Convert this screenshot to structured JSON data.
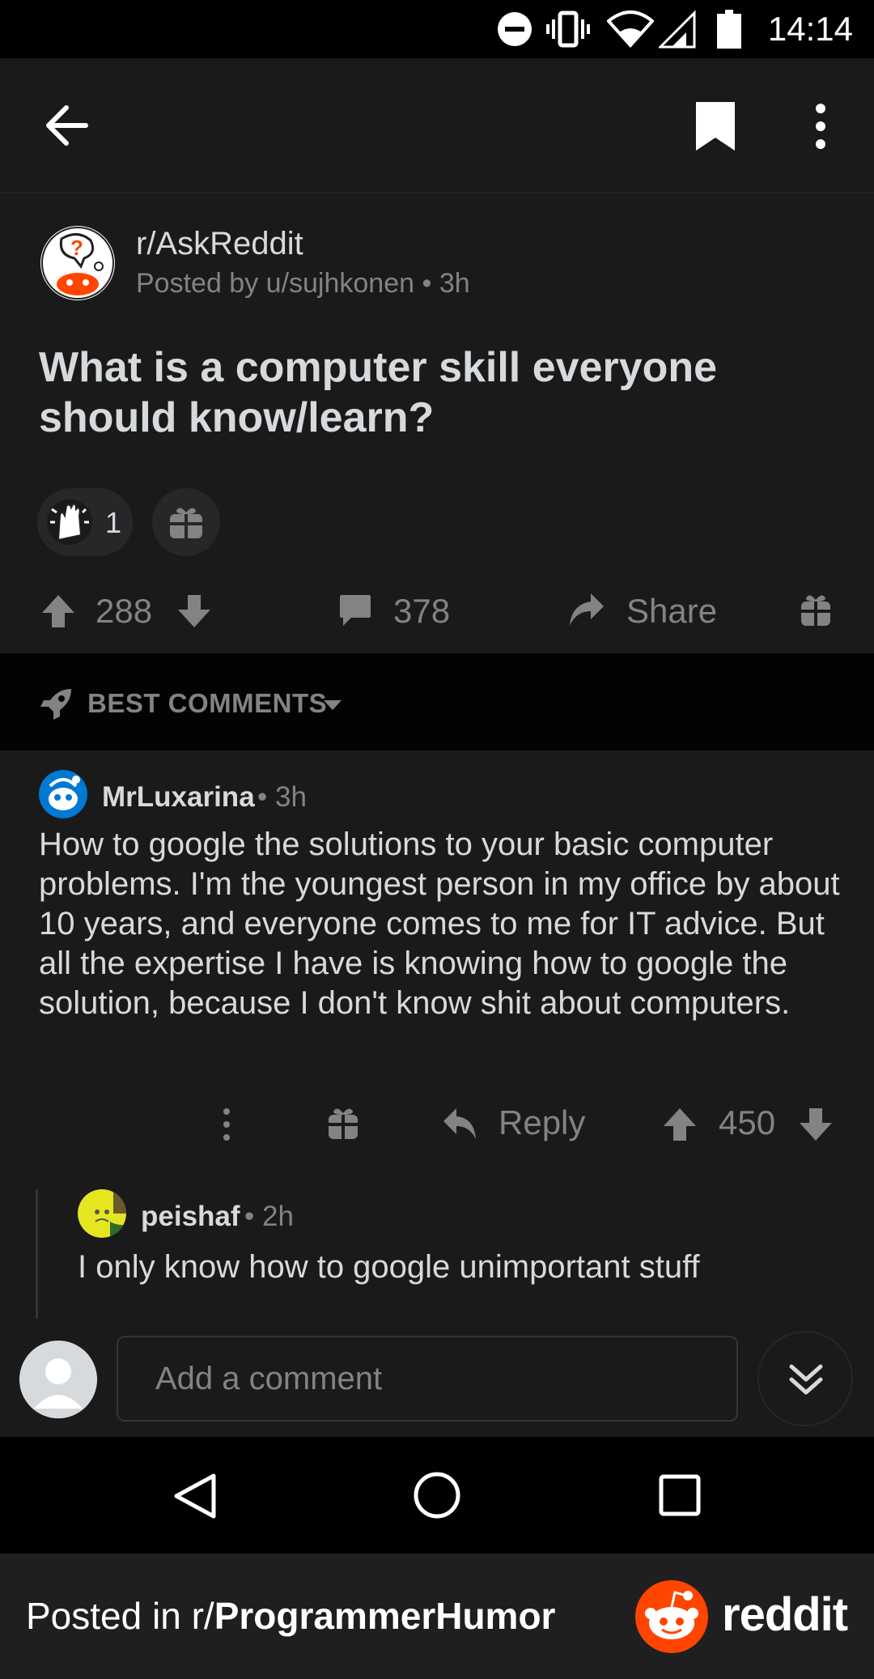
{
  "status_bar": {
    "time": "14:14"
  },
  "post": {
    "subreddit": "r/AskReddit",
    "posted_by": "Posted by u/sujhkonen",
    "age": "3h",
    "title": "What is a computer skill everyone should know/learn?",
    "award_count": "1",
    "score": "288",
    "comment_count": "378",
    "share_label": "Share"
  },
  "sort": {
    "label": "BEST COMMENTS"
  },
  "comments": [
    {
      "author": "MrLuxarina",
      "age": "3h",
      "body": "How to google the solutions to your basic computer problems. I'm the youngest person in my office by about 10 years, and everyone comes to me for IT advice. But all the expertise I have is knowing how to google the solution, because I don't know shit about computers.",
      "reply_label": "Reply",
      "score": "450"
    },
    {
      "author": "peishaf",
      "age": "2h",
      "body": "I only know how to google unimportant stuff"
    }
  ],
  "composer": {
    "placeholder": "Add a comment"
  },
  "footer": {
    "prefix": "Posted in r/",
    "subreddit": "ProgrammerHumor",
    "brand": "reddit",
    "brand_color": "#ff4500"
  },
  "colors": {
    "background": "#1a1a1b",
    "text": "#d7dadc",
    "muted": "#818384"
  }
}
